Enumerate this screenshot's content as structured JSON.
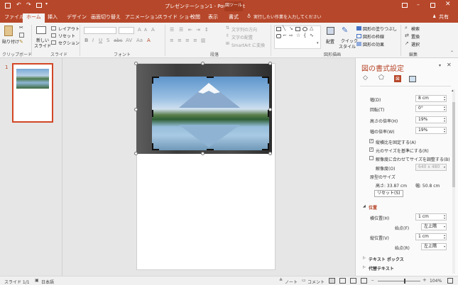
{
  "titlebar": {
    "title": "プレゼンテーション1 - PowerPoint",
    "context_tab_group": "図ツール"
  },
  "tabs": [
    {
      "label": "ファイル"
    },
    {
      "label": "ホーム"
    },
    {
      "label": "挿入"
    },
    {
      "label": "デザイン"
    },
    {
      "label": "画面切り替え"
    },
    {
      "label": "アニメーション"
    },
    {
      "label": "スライド ショー"
    },
    {
      "label": "校閲"
    },
    {
      "label": "表示"
    },
    {
      "label": "書式"
    }
  ],
  "tell_me": "実行したい作業を入力してください",
  "share": "共有",
  "ribbon": {
    "clipboard": {
      "paste": "貼り付け",
      "group": "クリップボード"
    },
    "slides": {
      "new_slide_line1": "新しい",
      "new_slide_line2": "スライド",
      "layout": "レイアウト",
      "reset": "リセット",
      "section": "セクション",
      "group": "スライド"
    },
    "font": {
      "group": "フォント"
    },
    "paragraph": {
      "text_direction": "文字列の方向",
      "align_text": "文字の配置",
      "smartart": "SmartArt に変換",
      "group": "段落"
    },
    "drawing": {
      "arrange": "配置",
      "quick_styles_line1": "クイック",
      "quick_styles_line2": "スタイル",
      "shape_fill": "図形の塗りつぶし",
      "shape_outline": "図形の枠線",
      "shape_effects": "図形の効果",
      "group": "図形描画"
    },
    "editing": {
      "find": "検索",
      "replace": "置換",
      "select": "選択",
      "group": "編集"
    }
  },
  "thumbnail": {
    "number": "1"
  },
  "pane": {
    "title": "図の書式設定",
    "width_label": "幅(D)",
    "width_value": "8 cm",
    "rotation_label": "回転(T)",
    "rotation_value": "0°",
    "scale_height_label": "高さの倍率(H)",
    "scale_height_value": "19%",
    "scale_width_label": "幅の倍率(W)",
    "scale_width_value": "19%",
    "lock_aspect_label": "縦横比を固定する(A)",
    "relative_label": "元のサイズを基準にする(R)",
    "best_scale_label": "解像度に合わせてサイズを調整する(B)",
    "resolution_label": "解像度(O)",
    "resolution_value": "640 x 480",
    "original_size_label": "原型のサイズ",
    "original_height": "高さ:  33.87 cm",
    "original_width": "幅:  50.8 cm",
    "reset_button": "リセット(S)",
    "position_section": "位置",
    "horizontal_label": "横位置(H)",
    "horizontal_value": "1 cm",
    "from_label_h": "始点(F)",
    "from_value_h": "左上隅",
    "vertical_label": "縦位置(V)",
    "vertical_value": "1 cm",
    "from_label_v": "始点(R)",
    "from_value_v": "左上隅",
    "textbox_section": "テキスト ボックス",
    "alttext_section": "代替テキスト"
  },
  "status": {
    "slide": "スライド 1/1",
    "language": "日本語",
    "notes": "ノート",
    "comments": "コメント",
    "zoom": "104%"
  },
  "colors": {
    "accent": "#b7472a"
  }
}
